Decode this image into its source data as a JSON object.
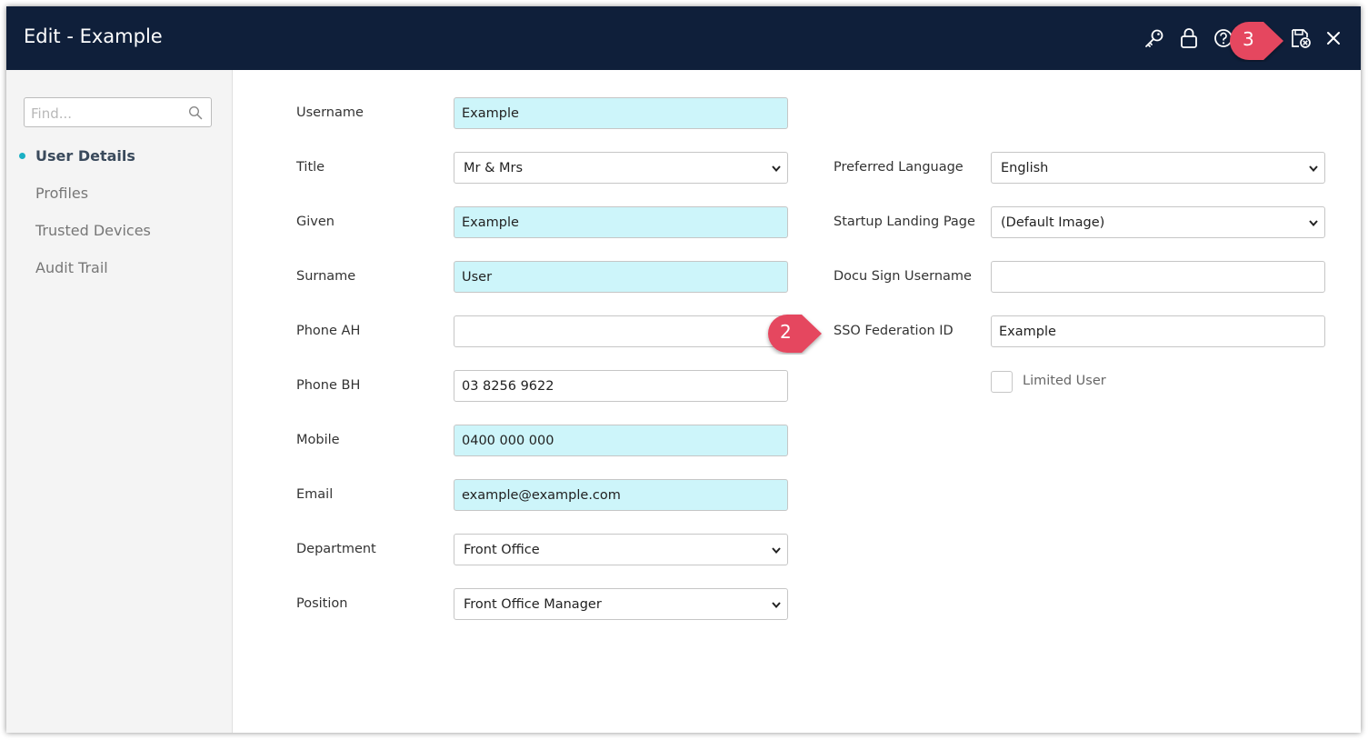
{
  "window": {
    "title": "Edit - Example"
  },
  "toolbar": {
    "icons": [
      "key-icon",
      "lock-icon",
      "help-icon",
      "save-close-icon",
      "close-icon"
    ]
  },
  "sidebar": {
    "search_placeholder": "Find...",
    "items": [
      {
        "label": "User Details",
        "active": true
      },
      {
        "label": "Profiles"
      },
      {
        "label": "Trusted Devices"
      },
      {
        "label": "Audit Trail"
      }
    ]
  },
  "form": {
    "username": {
      "label": "Username",
      "value": "Example"
    },
    "title": {
      "label": "Title",
      "value": "Mr & Mrs"
    },
    "given": {
      "label": "Given",
      "value": "Example"
    },
    "surname": {
      "label": "Surname",
      "value": "User"
    },
    "phone_ah": {
      "label": "Phone AH",
      "value": ""
    },
    "phone_bh": {
      "label": "Phone BH",
      "value": "03 8256 9622"
    },
    "mobile": {
      "label": "Mobile",
      "value": "0400 000 000"
    },
    "email": {
      "label": "Email",
      "value": "example@example.com"
    },
    "department": {
      "label": "Department",
      "value": "Front Office"
    },
    "position": {
      "label": "Position",
      "value": "Front Office Manager"
    },
    "preferred_language": {
      "label": "Preferred Language",
      "value": "English"
    },
    "startup_landing_page": {
      "label": "Startup Landing Page",
      "value": "(Default Image)"
    },
    "docu_sign_username": {
      "label": "Docu Sign Username",
      "value": ""
    },
    "sso_federation_id": {
      "label": "SSO Federation ID",
      "value": "Example"
    },
    "limited_user": {
      "label": "Limited User",
      "checked": false
    }
  },
  "annotations": {
    "badge_2": "2",
    "badge_3": "3",
    "color": "#e5475f"
  },
  "colors": {
    "titlebar": "#0f1f3a",
    "required_field": "#cdf5fa",
    "accent": "#1ab0c4"
  }
}
